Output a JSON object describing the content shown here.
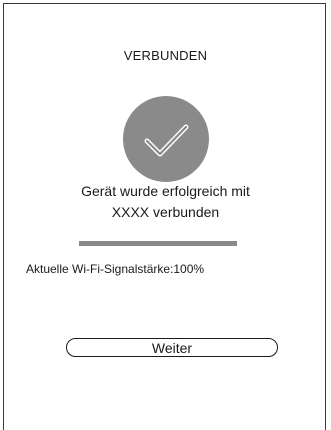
{
  "status": {
    "title": "VERBUNDEN",
    "icon": "check-icon",
    "circle_color": "#8a8a8a"
  },
  "message": {
    "line1": "Gerät wurde erfolgreich mit",
    "line2": "XXXX verbunden"
  },
  "progress": {
    "fraction": 1.0,
    "fill_color": "#8a8a8a"
  },
  "signal": {
    "label": "Aktuelle Wi-Fi-Signalstärke:",
    "value": "100%"
  },
  "actions": {
    "continue_label": "Weiter"
  }
}
